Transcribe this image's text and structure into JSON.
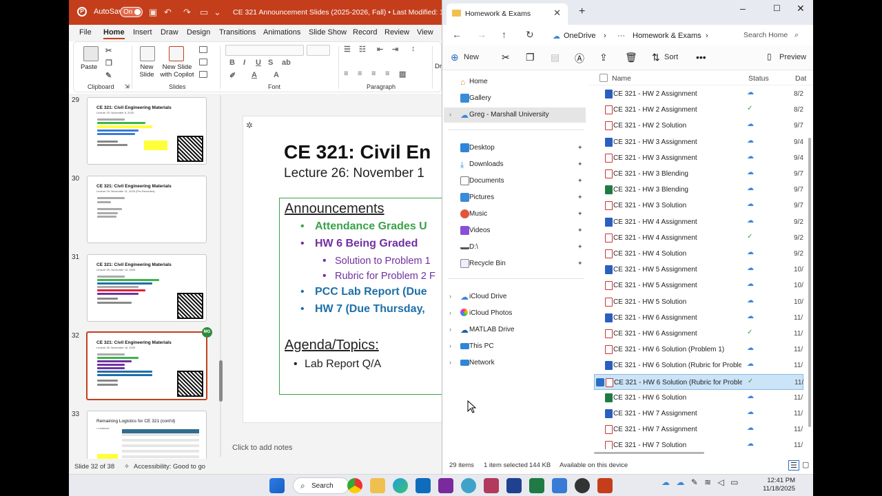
{
  "ppt": {
    "autosave_label": "AutoSave",
    "autosave_state": "On",
    "document_title": "CE 321 Announcement Slides (2025-2026, Fall) • Last Modified: 10m ago",
    "menu": [
      "File",
      "Home",
      "Insert",
      "Draw",
      "Design",
      "Transitions",
      "Animations",
      "Slide Show",
      "Record",
      "Review",
      "View"
    ],
    "active_menu": "Home",
    "ribbon": {
      "paste": "Paste",
      "clipboard": "Clipboard",
      "new_slide": "New Slide",
      "new_slide_copilot": "New Slide with Copilot",
      "slides": "Slides",
      "font": "Font",
      "paragraph": "Paragraph",
      "draw_partial": "Dra"
    },
    "thumbnails": [
      {
        "num": "29",
        "title": "CE 321: Civil Engineering Materials",
        "sub": "Lecture 23: November 6, 2025"
      },
      {
        "num": "30",
        "title": "CE 321: Civil Engineering Materials",
        "sub": "Lecture 24: November 11, 2025 (Pre-Recorded)"
      },
      {
        "num": "31",
        "title": "CE 321: Civil Engineering Materials",
        "sub": "Lecture 25: November 13, 2025"
      },
      {
        "num": "32",
        "title": "CE 321: Civil Engineering Materials",
        "sub": "Lecture 26: November 18, 2025"
      },
      {
        "num": "33",
        "title": "Remaining Logistics for CE 321 (cont'd)",
        "sub": "• Lectures:"
      }
    ],
    "coauthor_badge": "MG",
    "slide": {
      "title": "CE 321:  Civil En",
      "subtitle": "Lecture 26:  November 1",
      "announcements": "Announcements",
      "b1": "Attendance Grades U",
      "b2": "HW 6 Being Graded",
      "s1": "Solution to Problem 1",
      "s2": "Rubric for Problem 2 F",
      "b3": "PCC Lab Report (Due",
      "b4": "HW 7 (Due Thursday,",
      "agenda": "Agenda/Topics:",
      "lr": "Lab Report Q/A"
    },
    "notes_placeholder": "Click to add notes",
    "status_slide": "Slide 32 of 38",
    "status_access": "Accessibility: Good to go",
    "colors": {
      "accent": "#c43e1c",
      "green": "#38a149",
      "purple": "#7030a0",
      "blue": "#1e6fa8"
    }
  },
  "explorer": {
    "tab_title": "Homework & Exams",
    "breadcrumb": [
      "OneDrive",
      "Homework & Exams"
    ],
    "search_placeholder": "Search Home",
    "cmd": {
      "new": "New",
      "sort": "Sort",
      "preview": "Preview"
    },
    "nav": {
      "home": "Home",
      "gallery": "Gallery",
      "account": "Greg - Marshall University",
      "desktop": "Desktop",
      "downloads": "Downloads",
      "documents": "Documents",
      "pictures": "Pictures",
      "music": "Music",
      "videos": "Videos",
      "d": "D:\\",
      "recycle": "Recycle Bin",
      "icloud_drive": "iCloud Drive",
      "icloud_photos": "iCloud Photos",
      "matlab": "MATLAB Drive",
      "thispc": "This PC",
      "network": "Network"
    },
    "columns": {
      "name": "Name",
      "status": "Status",
      "date": "Dat"
    },
    "files": [
      {
        "name": "CE 321 - HW 2 Assignment",
        "type": "word",
        "status": "cloud",
        "date": "8/2"
      },
      {
        "name": "CE 321 - HW 2 Assignment",
        "type": "pdf",
        "status": "synced",
        "date": "8/2"
      },
      {
        "name": "CE 321 - HW 2 Solution",
        "type": "pdf",
        "status": "cloud",
        "date": "9/7"
      },
      {
        "name": "CE 321 - HW 3 Assignment",
        "type": "word",
        "status": "cloud",
        "date": "9/4"
      },
      {
        "name": "CE 321 - HW 3 Assignment",
        "type": "pdf",
        "status": "cloud",
        "date": "9/4"
      },
      {
        "name": "CE 321 - HW 3 Blending",
        "type": "pdf",
        "status": "cloud",
        "date": "9/7"
      },
      {
        "name": "CE 321 - HW 3 Blending",
        "type": "excel",
        "status": "cloud",
        "date": "9/7"
      },
      {
        "name": "CE 321 - HW 3 Solution",
        "type": "pdf",
        "status": "cloud",
        "date": "9/7"
      },
      {
        "name": "CE 321 - HW 4 Assignment",
        "type": "word",
        "status": "cloud",
        "date": "9/2"
      },
      {
        "name": "CE 321 - HW 4 Assignment",
        "type": "pdf",
        "status": "synced",
        "date": "9/2"
      },
      {
        "name": "CE 321 - HW 4 Solution",
        "type": "pdf",
        "status": "cloud",
        "date": "9/2"
      },
      {
        "name": "CE 321 - HW 5 Assignment",
        "type": "word",
        "status": "cloud",
        "date": "10/"
      },
      {
        "name": "CE 321 - HW 5 Assignment",
        "type": "pdf",
        "status": "cloud",
        "date": "10/"
      },
      {
        "name": "CE 321 - HW 5 Solution",
        "type": "pdf",
        "status": "cloud",
        "date": "10/"
      },
      {
        "name": "CE 321 - HW 6 Assignment",
        "type": "word",
        "status": "cloud",
        "date": "11/"
      },
      {
        "name": "CE 321 - HW 6 Assignment",
        "type": "pdf",
        "status": "synced",
        "date": "11/"
      },
      {
        "name": "CE 321 - HW 6 Solution (Problem 1)",
        "type": "pdf",
        "status": "cloud",
        "date": "11/"
      },
      {
        "name": "CE 321 - HW 6 Solution (Rubric for Problem ...",
        "type": "word",
        "status": "cloud",
        "date": "11/"
      },
      {
        "name": "CE 321 - HW 6 Solution (Rubric for Problem ...",
        "type": "pdf",
        "status": "synced",
        "date": "11/",
        "selected": true
      },
      {
        "name": "CE 321 - HW 6 Solution",
        "type": "excel",
        "status": "cloud",
        "date": "11/"
      },
      {
        "name": "CE 321 - HW 7 Assignment",
        "type": "word",
        "status": "cloud",
        "date": "11/"
      },
      {
        "name": "CE 321 - HW 7 Assignment",
        "type": "pdf",
        "status": "cloud",
        "date": "11/"
      },
      {
        "name": "CE 321 - HW 7 Solution",
        "type": "pdf",
        "status": "cloud",
        "date": "11/"
      }
    ],
    "status": {
      "items": "29 items",
      "selected": "1 item selected",
      "size": "144 KB",
      "availability": "Available on this device"
    }
  },
  "taskbar": {
    "search": "Search",
    "time": "12:41 PM",
    "date": "11/18/2025"
  }
}
